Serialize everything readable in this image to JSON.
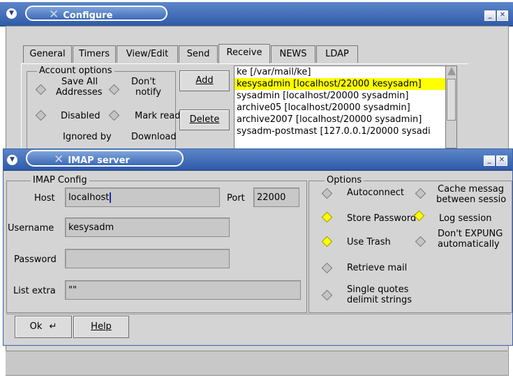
{
  "configure": {
    "title": "Configure",
    "tabs": [
      "General",
      "Timers",
      "View/Edit",
      "Send",
      "Receive",
      "NEWS",
      "LDAP"
    ],
    "active_tab": "Receive",
    "account_options": {
      "label": "Account options",
      "save_all_1": "Save All",
      "save_all_2": "Addresses",
      "dont_notify_1": "Don't",
      "dont_notify_2": "notify",
      "disabled": "Disabled",
      "mark_read": "Mark read",
      "ignored_by": "Ignored by",
      "download": "Download"
    },
    "add_button": "Add",
    "delete_button": "Delete",
    "accounts": [
      "ke [/var/mail/ke]",
      "kesysadmin [localhost/22000 kesysadm]",
      "sysadmin [localhost/20000 sysadmin]",
      "archive05 [localhost/20000 sysadmin]",
      "archive2007 [localhost/20000 sysadmin]",
      "sysadm-postmast [127.0.0.1/20000 sysadi"
    ],
    "selected_account_index": 1
  },
  "imap": {
    "title": "IMAP server",
    "config_label": "IMAP Config",
    "host_label": "Host",
    "host_value": "localhost",
    "port_label": "Port",
    "port_value": "22000",
    "username_label": "Username",
    "username_value": "kesysadm",
    "password_label": "Password",
    "password_value": "",
    "list_extra_label": "List extra",
    "list_extra_value": "\"\"",
    "options_label": "Options",
    "options": {
      "autoconnect": "Autoconnect",
      "cache_1": "Cache messag",
      "cache_2": "between sessio",
      "store_password": "Store Password",
      "log_session": "Log session",
      "use_trash": "Use Trash",
      "dont_expunge_1": "Don't EXPUNG",
      "dont_expunge_2": "automatically",
      "retrieve_mail": "Retrieve mail",
      "single_quotes_1": "Single quotes",
      "single_quotes_2": "delimit strings"
    },
    "ok_button": "Ok",
    "help_button": "Help"
  },
  "colors": {
    "titlebar": "#3d69b5",
    "panel": "#d4d4d4",
    "selection": "#ffff00",
    "radio_on": "#ffff00"
  }
}
